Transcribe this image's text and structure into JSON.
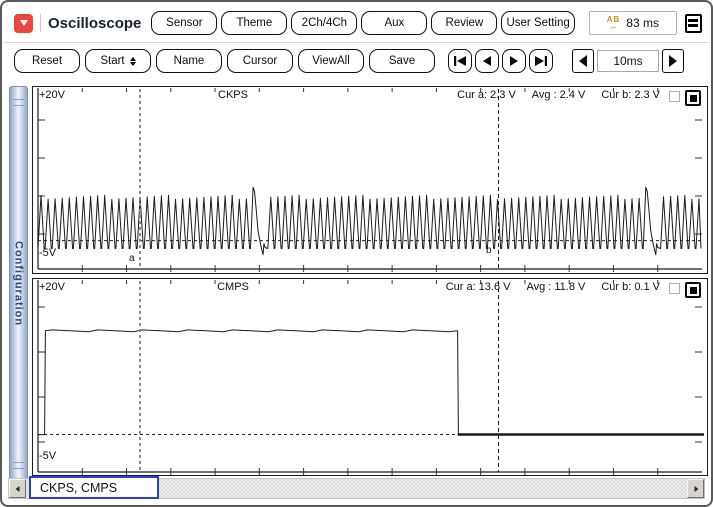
{
  "window": {
    "title": "Oscilloscope"
  },
  "toolbar_top": {
    "buttons": [
      {
        "label": "Sensor"
      },
      {
        "label": "Theme"
      },
      {
        "label": "2Ch/4Ch"
      },
      {
        "label": "Aux"
      },
      {
        "label": "Review"
      },
      {
        "label": "User Setting"
      }
    ],
    "measure_display": {
      "icon_text": "AB",
      "value": "83 ms"
    }
  },
  "toolbar_main": {
    "buttons": [
      {
        "label": "Reset"
      },
      {
        "label": "Start"
      },
      {
        "label": "Name"
      },
      {
        "label": "Cursor"
      },
      {
        "label": "ViewAll"
      },
      {
        "label": "Save"
      }
    ],
    "timebase": {
      "value": "10ms"
    }
  },
  "sidebar": {
    "label": "Configuration"
  },
  "statusbar": {
    "channels_label": "CKPS, CMPS"
  },
  "chart_data": [
    {
      "type": "line",
      "name": "CKPS",
      "y_top_label": "+20V",
      "y_bottom_label": "-5V",
      "ylim": [
        -5,
        20
      ],
      "t_span_ms": 150,
      "time_per_div": "10ms",
      "measurements": [
        {
          "label": "Cur a:",
          "value": "2.3 V"
        },
        {
          "label": "Avg :",
          "value": "2.4 V"
        },
        {
          "label": "Cur b:",
          "value": "2.3 V"
        }
      ],
      "cursors": {
        "a_ms": 23,
        "b_ms": 104,
        "a_label": "a",
        "b_label": "b"
      },
      "waveform": {
        "kind": "crank-toothed",
        "v_high": 4.4,
        "v_low": -3.4,
        "v_baseline": -2.2,
        "tooth_period_ms": 1.6,
        "missing_tooth_at_ms": [
          48,
          138.3
        ]
      }
    },
    {
      "type": "line",
      "name": "CMPS",
      "y_top_label": "+20V",
      "y_bottom_label": "-5V",
      "ylim": [
        -5,
        20
      ],
      "t_span_ms": 150,
      "time_per_div": "10ms",
      "measurements": [
        {
          "label": "Cur a:",
          "value": "13.6 V"
        },
        {
          "label": "Avg :",
          "value": "11.8 V"
        },
        {
          "label": "Cur b:",
          "value": "0.1 V"
        }
      ],
      "cursors": {
        "a_ms": 23,
        "b_ms": 104
      },
      "waveform": {
        "kind": "square",
        "v_high": 13.7,
        "v_low": 0.1,
        "v_baseline": -1.2,
        "rise_at_ms": 1.5,
        "fall_at_ms": 94.8
      }
    }
  ]
}
